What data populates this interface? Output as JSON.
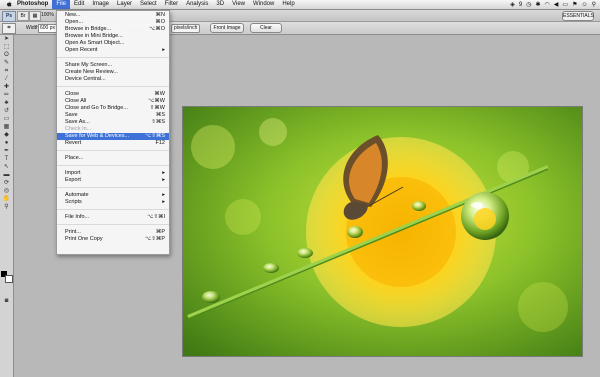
{
  "menubar": {
    "app": "Photoshop",
    "items": [
      "File",
      "Edit",
      "Image",
      "Layer",
      "Select",
      "Filter",
      "Analysis",
      "3D",
      "View",
      "Window",
      "Help"
    ],
    "status": {
      "badge": "9"
    }
  },
  "toolbar1": {
    "ps": "Ps",
    "zoom": "100%"
  },
  "options": {
    "width_label": "Width:",
    "width_value": "600 px",
    "resolution_unit": "pixels/inch",
    "front_image": "Front Image",
    "clear": "Clear"
  },
  "file_menu": {
    "groups": [
      [
        {
          "label": "New...",
          "shortcut": "⌘N"
        },
        {
          "label": "Open...",
          "shortcut": "⌘O"
        },
        {
          "label": "Browse in Bridge...",
          "shortcut": "⌥⌘O"
        },
        {
          "label": "Browse in Mini Bridge...",
          "shortcut": ""
        },
        {
          "label": "Open As Smart Object...",
          "shortcut": ""
        },
        {
          "label": "Open Recent",
          "shortcut": "▸"
        }
      ],
      [
        {
          "label": "Share My Screen...",
          "shortcut": ""
        },
        {
          "label": "Create New Review...",
          "shortcut": ""
        },
        {
          "label": "Device Central...",
          "shortcut": ""
        }
      ],
      [
        {
          "label": "Close",
          "shortcut": "⌘W"
        },
        {
          "label": "Close All",
          "shortcut": "⌥⌘W"
        },
        {
          "label": "Close and Go To Bridge...",
          "shortcut": "⇧⌘W"
        },
        {
          "label": "Save",
          "shortcut": "⌘S"
        },
        {
          "label": "Save As...",
          "shortcut": "⇧⌘S"
        },
        {
          "label": "Check In...",
          "shortcut": "",
          "disabled": true
        },
        {
          "label": "Save for Web & Devices...",
          "shortcut": "⌥⇧⌘S",
          "highlighted": true
        },
        {
          "label": "Revert",
          "shortcut": "F12"
        }
      ],
      [
        {
          "label": "Place...",
          "shortcut": ""
        }
      ],
      [
        {
          "label": "Import",
          "shortcut": "▸"
        },
        {
          "label": "Export",
          "shortcut": "▸"
        }
      ],
      [
        {
          "label": "Automate",
          "shortcut": "▸"
        },
        {
          "label": "Scripts",
          "shortcut": "▸"
        }
      ],
      [
        {
          "label": "File Info...",
          "shortcut": "⌥⇧⌘I"
        }
      ],
      [
        {
          "label": "Print...",
          "shortcut": "⌘P"
        },
        {
          "label": "Print One Copy",
          "shortcut": "⌥⇧⌘P"
        }
      ]
    ]
  },
  "tools": [
    {
      "name": "move-tool-icon",
      "glyph": "➤"
    },
    {
      "name": "marquee-tool-icon",
      "glyph": "⬚"
    },
    {
      "name": "lasso-tool-icon",
      "glyph": "ʘ"
    },
    {
      "name": "quick-select-tool-icon",
      "glyph": "✎"
    },
    {
      "name": "crop-tool-icon",
      "glyph": "⌗"
    },
    {
      "name": "eyedropper-tool-icon",
      "glyph": "⁄"
    },
    {
      "name": "healing-tool-icon",
      "glyph": "✚"
    },
    {
      "name": "brush-tool-icon",
      "glyph": "✏"
    },
    {
      "name": "stamp-tool-icon",
      "glyph": "♣"
    },
    {
      "name": "history-brush-icon",
      "glyph": "↺"
    },
    {
      "name": "eraser-tool-icon",
      "glyph": "▭"
    },
    {
      "name": "gradient-tool-icon",
      "glyph": "▦"
    },
    {
      "name": "blur-tool-icon",
      "glyph": "◆"
    },
    {
      "name": "dodge-tool-icon",
      "glyph": "●"
    },
    {
      "name": "pen-tool-icon",
      "glyph": "✒"
    },
    {
      "name": "type-tool-icon",
      "glyph": "T"
    },
    {
      "name": "path-select-icon",
      "glyph": "↖"
    },
    {
      "name": "shape-tool-icon",
      "glyph": "▬"
    },
    {
      "name": "3d-rotate-icon",
      "glyph": "⟳"
    },
    {
      "name": "3d-orbit-icon",
      "glyph": "◎"
    },
    {
      "name": "hand-tool-icon",
      "glyph": "✋"
    },
    {
      "name": "zoom-tool-icon",
      "glyph": "⚲"
    }
  ],
  "colors": {
    "foreground": "#000000",
    "background": "#ffffff",
    "menu_highlight": "#3f72d8"
  }
}
